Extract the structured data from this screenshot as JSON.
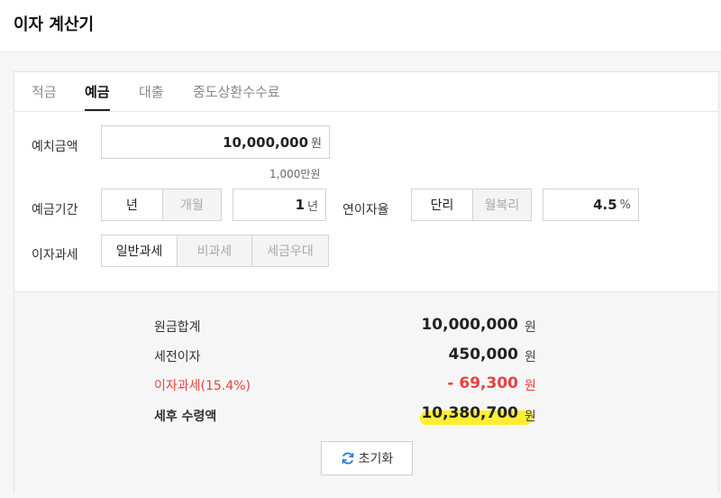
{
  "app": {
    "title": "이자 계산기"
  },
  "tabs": [
    {
      "label": "적금"
    },
    {
      "label": "예금"
    },
    {
      "label": "대출"
    },
    {
      "label": "중도상환수수료"
    }
  ],
  "form": {
    "deposit": {
      "label": "예치금액",
      "value": "10,000,000",
      "unit": "원",
      "hint": "1,000만원"
    },
    "period": {
      "label": "예금기간",
      "opt_year": "년",
      "opt_month": "개월",
      "value": "1",
      "unit": "년",
      "selected": "년"
    },
    "rate": {
      "label": "연이자율",
      "opt_simple": "단리",
      "opt_monthly": "월복리",
      "value": "4.5",
      "unit": "%",
      "selected": "단리"
    },
    "tax": {
      "label": "이자과세",
      "opt_general": "일반과세",
      "opt_none": "비과세",
      "opt_preferential": "세금우대",
      "selected": "일반과세"
    }
  },
  "result": {
    "principal": {
      "label": "원금합계",
      "value": "10,000,000",
      "unit": "원"
    },
    "pretax": {
      "label": "세전이자",
      "value": "450,000",
      "unit": "원"
    },
    "tax": {
      "label": "이자과세(15.4%)",
      "value": "- 69,300",
      "unit": "원"
    },
    "net": {
      "label": "세후 수령액",
      "value": "10,380,700",
      "unit": "원"
    }
  },
  "reset": {
    "label": "초기화"
  },
  "colors": {
    "accent_red": "#e94040",
    "highlight": "#ffee33"
  }
}
